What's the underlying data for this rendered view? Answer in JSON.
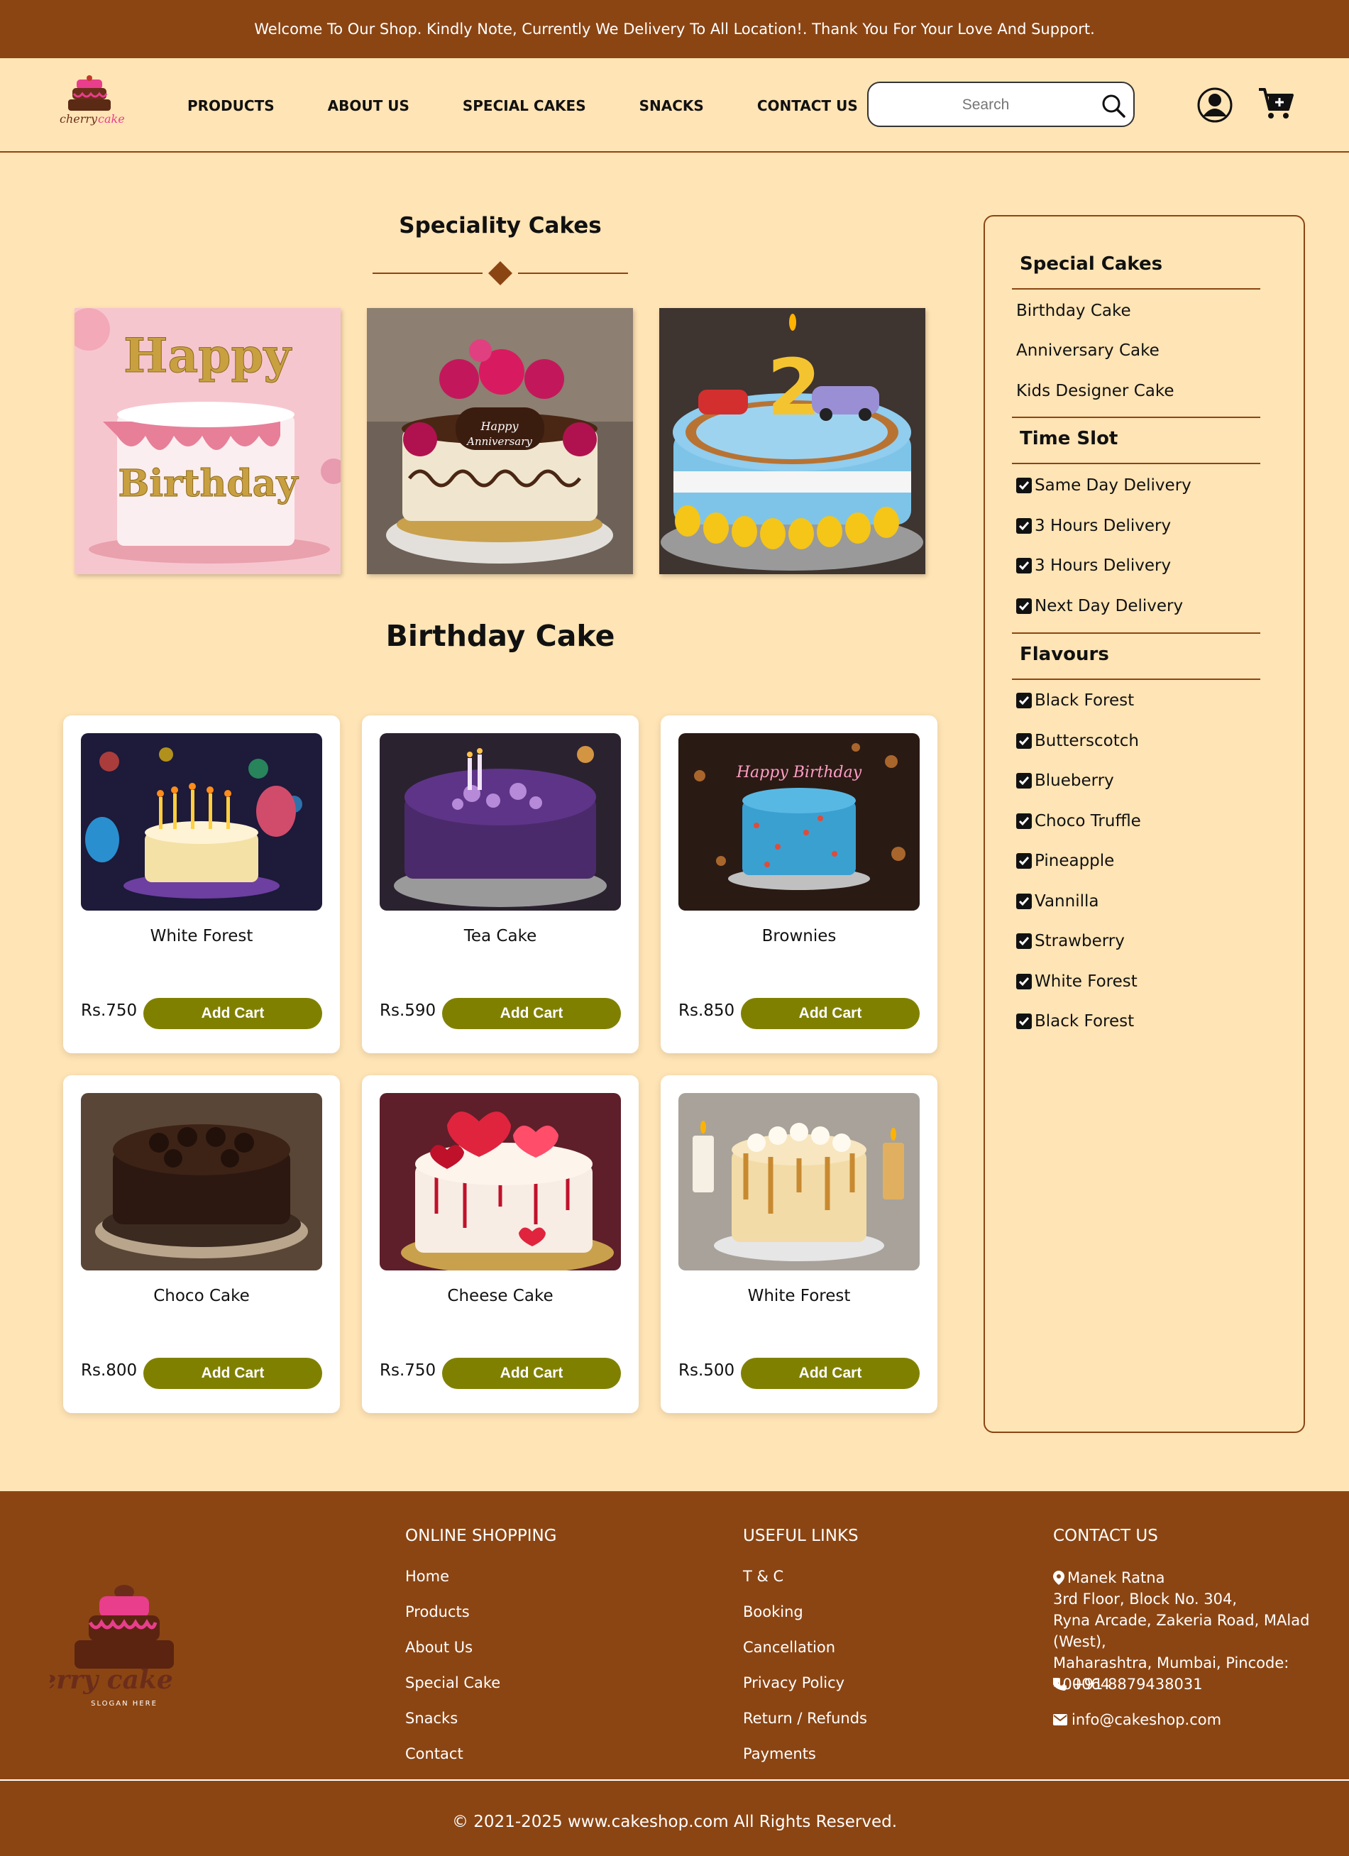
{
  "announcement": "Welcome To Our Shop. Kindly Note, Currently We Delivery To All Location!. Thank You For Your Love And Support.",
  "nav": [
    "PRODUCTS",
    "ABOUT US",
    "SPECIAL CAKES",
    "SNACKS",
    "CONTACT US"
  ],
  "search": {
    "placeholder": "Search"
  },
  "speciality": {
    "title": "Speciality Cakes",
    "images": [
      {
        "caption_top": "Happy",
        "caption_bottom": "Birthday"
      },
      {
        "caption_top": "Happy",
        "caption_bottom": "Anniversary"
      },
      {
        "number": "2"
      }
    ]
  },
  "section_title": "Birthday Cake",
  "products": [
    {
      "name": "White Forest",
      "price": "Rs.750",
      "button": "Add Cart",
      "photo_text": ""
    },
    {
      "name": "Tea Cake",
      "price": "Rs.590",
      "button": "Add Cart",
      "photo_text": ""
    },
    {
      "name": "Brownies",
      "price": "Rs.850",
      "button": "Add Cart",
      "photo_text": "Happy Birthday"
    },
    {
      "name": "Choco Cake",
      "price": "Rs.800",
      "button": "Add Cart",
      "photo_text": ""
    },
    {
      "name": "Cheese Cake",
      "price": "Rs.750",
      "button": "Add Cart",
      "photo_text": ""
    },
    {
      "name": "White Forest",
      "price": "Rs.500",
      "button": "Add Cart",
      "photo_text": ""
    }
  ],
  "sidebar": {
    "special_heading": "Special Cakes",
    "special_items": [
      "Birthday Cake",
      "Anniversary Cake",
      "Kids Designer Cake"
    ],
    "time_heading": "Time Slot",
    "time_items": [
      "Same Day Delivery",
      "3 Hours Delivery",
      "3 Hours Delivery",
      "Next Day Delivery"
    ],
    "flavour_heading": "Flavours",
    "flavour_items": [
      "Black Forest",
      "Butterscotch",
      "Blueberry",
      "Choco Truffle",
      "Pineapple",
      "Vannilla",
      "Strawberry",
      "White Forest",
      "Black Forest"
    ]
  },
  "footer": {
    "logo_text": "cherry cake",
    "logo_slogan": "SLOGAN HERE",
    "online_heading": "ONLINE SHOPPING",
    "online_links": [
      "Home",
      "Products",
      "About Us",
      "Special Cake",
      "Snacks",
      "Contact"
    ],
    "useful_heading": "USEFUL LINKS",
    "useful_links": [
      "T & C",
      "Booking",
      "Cancellation",
      "Privacy Policy",
      "Return / Refunds",
      "Payments"
    ],
    "contact_heading": "CONTACT US",
    "address_lines": [
      "Manek Ratna",
      "3rd Floor, Block No. 304,",
      "Ryna Arcade, Zakeria Road, MAlad (West),",
      "Maharashtra, Mumbai, Pincode: 400064"
    ],
    "phone": "+91 8879438031",
    "email": "info@cakeshop.com",
    "copyright": "© 2021-2025 www.cakeshop.com All Rights Reserved."
  },
  "colors": {
    "brown": "#8b4513",
    "cream": "#ffe4b5",
    "olive": "#808000"
  }
}
